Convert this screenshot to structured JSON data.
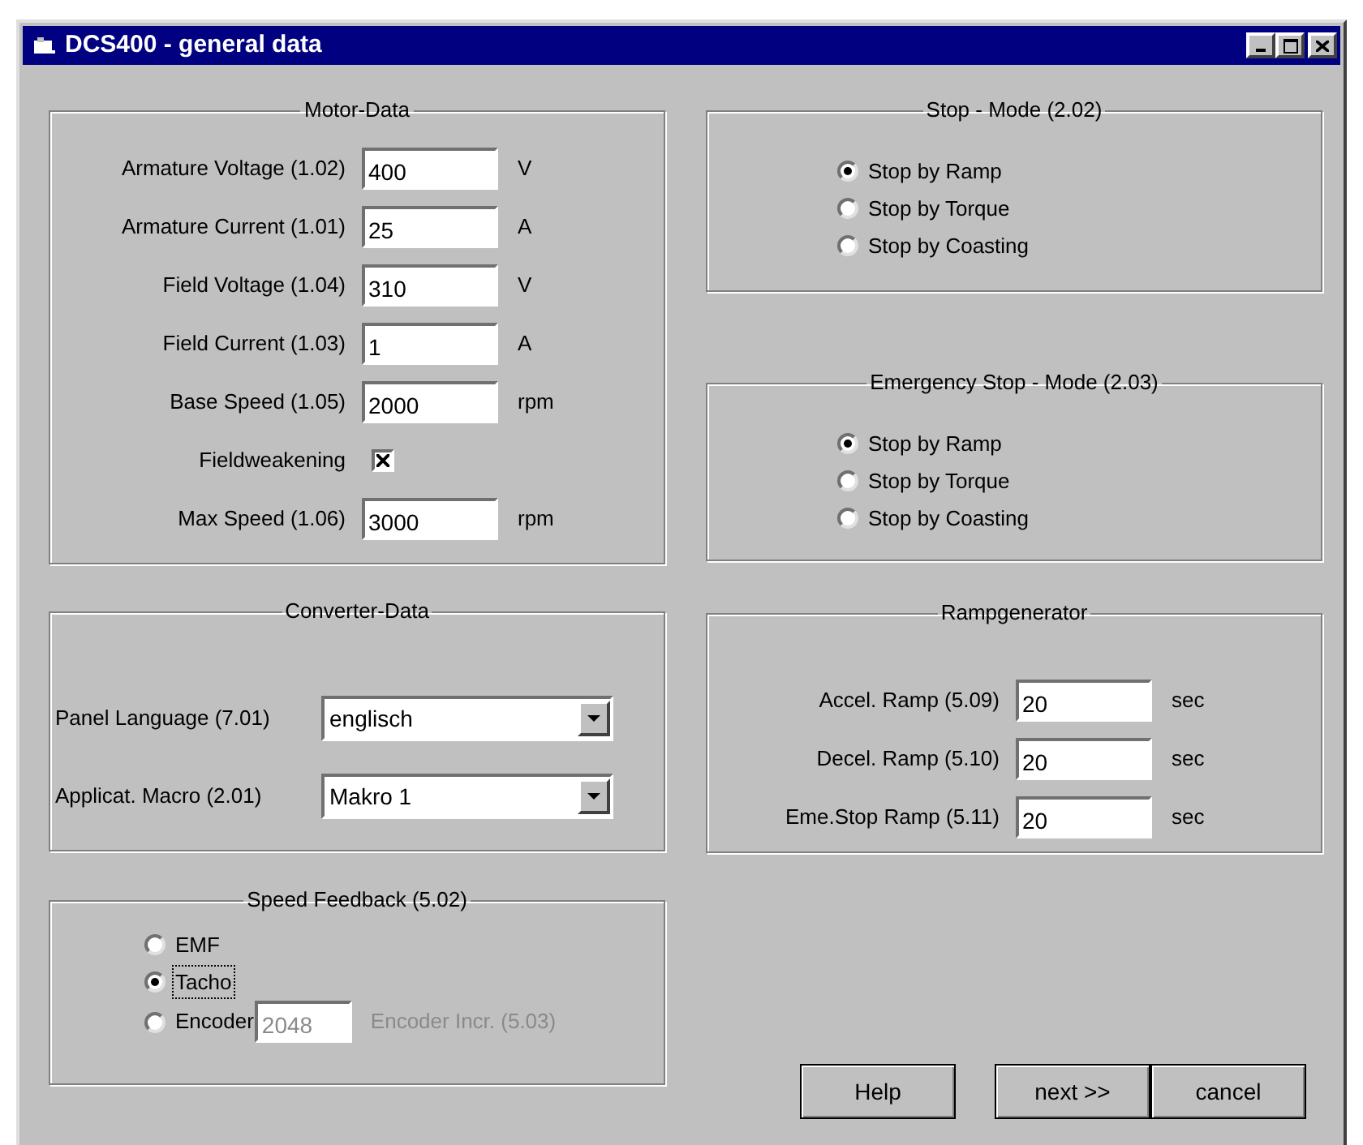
{
  "window": {
    "title": "DCS400 - general data"
  },
  "motor_data": {
    "title": "Motor-Data",
    "rows": [
      {
        "kind": "field",
        "label": "Armature Voltage (1.02)",
        "value": "400",
        "unit": "V"
      },
      {
        "kind": "field",
        "label": "Armature Current (1.01)",
        "value": "25",
        "unit": "A"
      },
      {
        "kind": "field",
        "label": "Field Voltage (1.04)",
        "value": "310",
        "unit": "V"
      },
      {
        "kind": "field",
        "label": "Field Current (1.03)",
        "value": "1",
        "unit": "A"
      },
      {
        "kind": "field",
        "label": "Base Speed (1.05)",
        "value": "2000",
        "unit": "rpm"
      },
      {
        "kind": "checkbox",
        "label": "Fieldweakening",
        "checked": true
      },
      {
        "kind": "field",
        "label": "Max Speed (1.06)",
        "value": "3000",
        "unit": "rpm"
      }
    ]
  },
  "converter_data": {
    "title": "Converter-Data",
    "rows": [
      {
        "label": "Panel Language (7.01)",
        "value": "englisch"
      },
      {
        "label": "Applicat. Macro (2.01)",
        "value": "Makro 1"
      }
    ]
  },
  "speed_feedback": {
    "title": "Speed Feedback (5.02)",
    "options": [
      {
        "label": "EMF",
        "selected": false,
        "focused": false
      },
      {
        "label": "Tacho",
        "selected": true,
        "focused": true
      },
      {
        "label": "Encoder",
        "selected": false,
        "focused": false
      }
    ],
    "encoder_field": {
      "value": "2048",
      "disabled": true,
      "label": "Encoder Incr. (5.03)"
    }
  },
  "stop_mode": {
    "title": "Stop - Mode (2.02)",
    "options": [
      {
        "label": "Stop by Ramp",
        "selected": true
      },
      {
        "label": "Stop by Torque",
        "selected": false
      },
      {
        "label": "Stop by Coasting",
        "selected": false
      }
    ]
  },
  "emergency_stop_mode": {
    "title": "Emergency Stop - Mode (2.03)",
    "options": [
      {
        "label": "Stop by Ramp",
        "selected": true
      },
      {
        "label": "Stop by Torque",
        "selected": false
      },
      {
        "label": "Stop by Coasting",
        "selected": false
      }
    ]
  },
  "rampgenerator": {
    "title": "Rampgenerator",
    "rows": [
      {
        "label": "Accel. Ramp (5.09)",
        "value": "20",
        "unit": "sec"
      },
      {
        "label": "Decel. Ramp (5.10)",
        "value": "20",
        "unit": "sec"
      },
      {
        "label": "Eme.Stop Ramp (5.11)",
        "value": "20",
        "unit": "sec"
      }
    ]
  },
  "buttons": [
    "Help",
    "next >>",
    "cancel"
  ]
}
